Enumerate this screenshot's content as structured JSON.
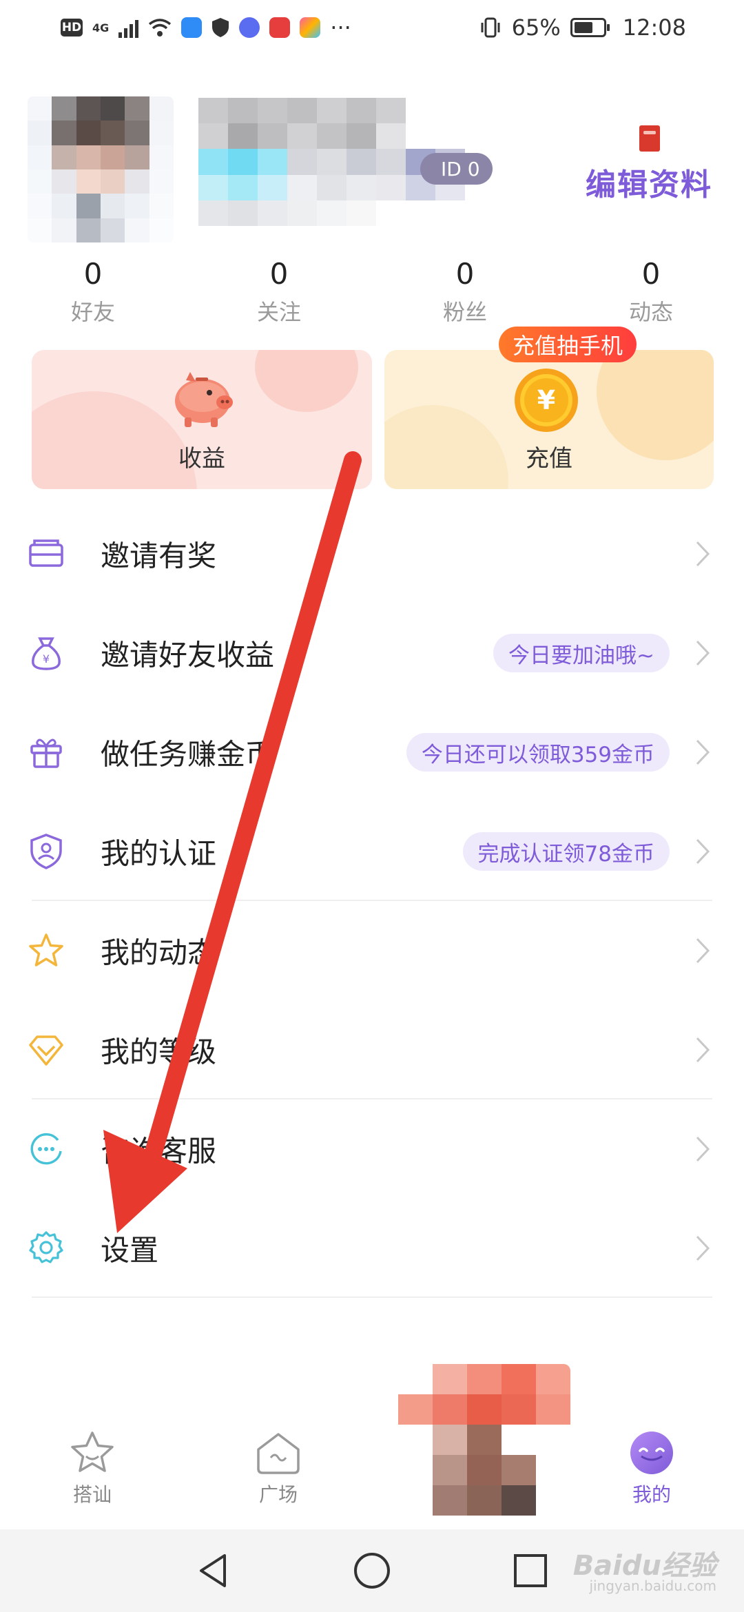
{
  "status_bar": {
    "hd": "HD",
    "network": "4G",
    "battery": "65%",
    "time": "12:08",
    "more": "···",
    "battery_level": 0.65
  },
  "profile": {
    "id_chip_text": "ID 0",
    "edit_label": "编辑资料"
  },
  "stats": [
    {
      "value": "0",
      "label": "好友"
    },
    {
      "value": "0",
      "label": "关注"
    },
    {
      "value": "0",
      "label": "粉丝"
    },
    {
      "value": "0",
      "label": "动态"
    }
  ],
  "cards": {
    "earnings_label": "收益",
    "recharge_label": "充值",
    "promo_tag": "充值抽手机",
    "coin_symbol": "¥"
  },
  "menu": [
    {
      "label": "邀请有奖",
      "icon": "envelope-icon",
      "tag": ""
    },
    {
      "label": "邀请好友收益",
      "icon": "money-bag-icon",
      "tag": "今日要加油哦~"
    },
    {
      "label": "做任务赚金币",
      "icon": "gift-icon",
      "tag": "今日还可以领取359金币"
    },
    {
      "label": "我的认证",
      "icon": "shield-user-icon",
      "tag": "完成认证领78金币"
    },
    {
      "label": "我的动态",
      "icon": "star-icon",
      "tag": ""
    },
    {
      "label": "我的等级",
      "icon": "diamond-icon",
      "tag": ""
    },
    {
      "label": "咨询客服",
      "icon": "chat-bubble-icon",
      "tag": ""
    },
    {
      "label": "设置",
      "icon": "gear-icon",
      "tag": ""
    }
  ],
  "bottom_nav": [
    {
      "label": "搭讪",
      "icon": "star-face-icon",
      "active": false
    },
    {
      "label": "广场",
      "icon": "square-house-icon",
      "active": false
    },
    {
      "label": "我的",
      "icon": "smile-face-icon",
      "active": true
    }
  ],
  "watermark": {
    "brand": "Baidu经验",
    "url": "jingyan.baidu.com"
  },
  "colors": {
    "accent": "#7e5bd8",
    "tag_bg": "#efe9fc",
    "arrow": "#e8392f",
    "earn_card": "#fde5e2",
    "recharge_card": "#fdf0d6"
  }
}
